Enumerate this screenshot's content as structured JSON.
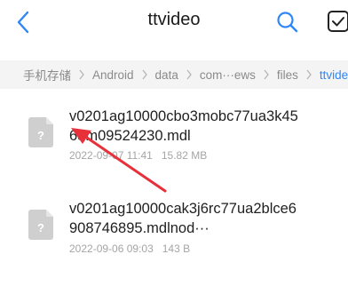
{
  "header": {
    "title": "ttvideo",
    "back_icon": "chevron-left-icon",
    "search_icon": "search-icon",
    "select_icon": "checkbox-icon",
    "accent_color": "#2f86f6"
  },
  "breadcrumb": {
    "items": [
      "手机存储",
      "Android",
      "data",
      "com···ews",
      "files",
      "ttvideo"
    ]
  },
  "files": [
    {
      "name": "v0201ag10000cbo3mobc77ua3k4565m09524230.mdl",
      "date": "2022-09-07 11:41",
      "size": "15.82 MB",
      "icon": "unknown-file-icon"
    },
    {
      "name": "v0201ag10000cak3j6rc77ua2blce6908746895.mdlnod···",
      "date": "2022-09-06 09:03",
      "size": "143 B",
      "icon": "unknown-file-icon"
    }
  ],
  "annotation": {
    "arrow_color": "#e8303a"
  }
}
